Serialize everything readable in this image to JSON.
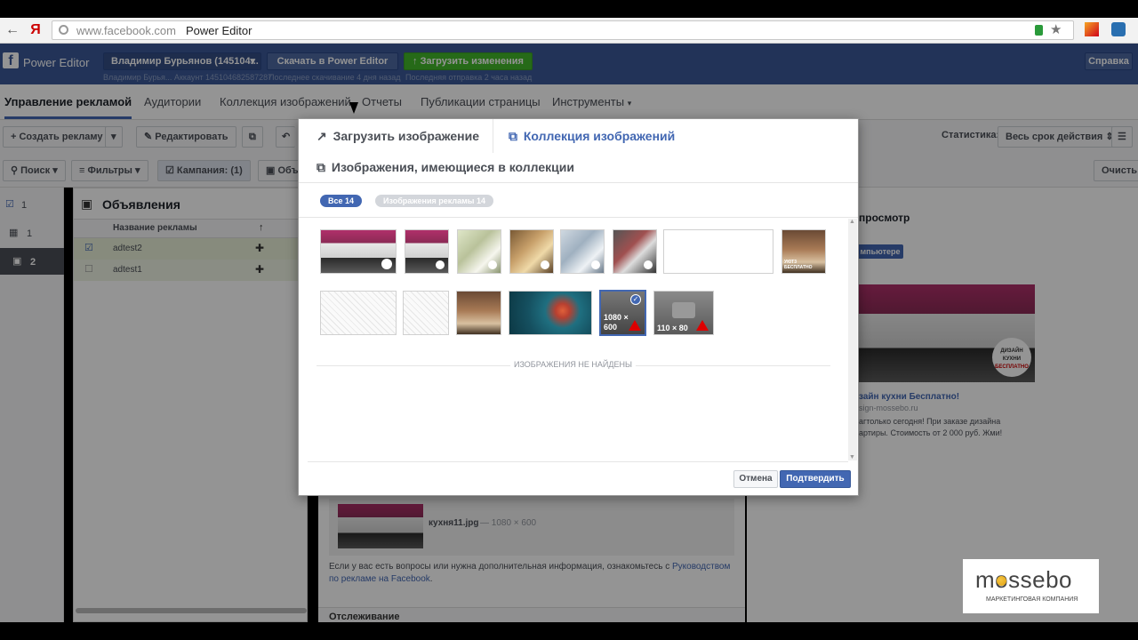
{
  "browser": {
    "host": "www.facebook.com",
    "page_title": "Power Editor"
  },
  "fb_header": {
    "app_name": "Power Editor",
    "account_label": "Владимир Бурьянов (145104...",
    "account_sub": "Владимир Бурья... Аккаунт 145104682587287",
    "download_label": "Скачать в Power Editor",
    "download_sub": "Последнее скачивание 4 дня назад",
    "upload_label": "Загрузить изменения",
    "upload_sub": "Последняя отправка 2 часа назад",
    "help_label": "Справка"
  },
  "tabs": [
    {
      "label": "Управление рекламой"
    },
    {
      "label": "Аудитории"
    },
    {
      "label": "Коллекция изображений"
    },
    {
      "label": "Отчеты"
    },
    {
      "label": "Публикации страницы"
    },
    {
      "label": "Инструменты"
    }
  ],
  "toolbar": {
    "create_label": "Создать рекламу",
    "edit_label": "Редактировать",
    "stats_label": "Статистика:",
    "period_label": "Весь срок действия"
  },
  "filters": {
    "search_label": "Поиск",
    "filters_label": "Фильтры",
    "campaign_label": "Кампания:",
    "campaign_count": "(1)",
    "obj_label": "Объ",
    "clear_label": "Очисть"
  },
  "left_pane": {
    "rows": [
      {
        "label": "1"
      },
      {
        "label": "1"
      },
      {
        "label": "2"
      }
    ]
  },
  "ads_panel": {
    "title": "Объявления",
    "col_name": "Название рекламы",
    "rows": [
      {
        "name": "adtest2",
        "checked": true
      },
      {
        "name": "adtest1",
        "checked": false
      }
    ]
  },
  "preview": {
    "title": "просмотр",
    "badge": "мпьютере",
    "headline": "зайн кухни Бесплатно!",
    "domain": "sign-mossebo.ru",
    "text_line1": "агтолько сегодня! При заказе дизайна",
    "text_line2": "артиры. Стоимость от 2 000 руб. Жми!",
    "stamp_line1": "ДИЗАЙН",
    "stamp_line2": "КУХНИ",
    "stamp_line3": "БЕСПЛАТНО"
  },
  "below_modal": {
    "file_name": "кухня11.jpg",
    "file_dims": "— 1080 × 600",
    "help_text_prefix": "Если у вас есть вопросы или нужна дополнительная информация, ознакомьтесь с ",
    "help_link": "Руководством по рекламе на Facebook",
    "help_suffix": ".",
    "next_section": "Отслеживание"
  },
  "modal": {
    "upload_tab": "Загрузить изображение",
    "collection_tab": "Коллекция изображений",
    "in_collection_tab": "Изображения, имеющиеся в коллекции",
    "pill_all": "Все  14",
    "pill_ads": "Изображения рекламы  14",
    "selected_dims": "1080 × 600",
    "small_dims": "110 × 80",
    "thumb_caption": "УЮТ3 БЕСПЛАТНО",
    "empty_text": "ИЗОБРАЖЕНИЯ НЕ НАЙДЕНЫ",
    "cancel_label": "Отмена",
    "confirm_label": "Подтвердить"
  },
  "watermark": {
    "brand": "mossebo",
    "tagline": "МАРКЕТИНГОВАЯ КОМПАНИЯ"
  },
  "colors": {
    "fb_blue": "#3b5998",
    "accent": "#4267b2",
    "green": "#42b72a",
    "warning": "#dd0000"
  }
}
